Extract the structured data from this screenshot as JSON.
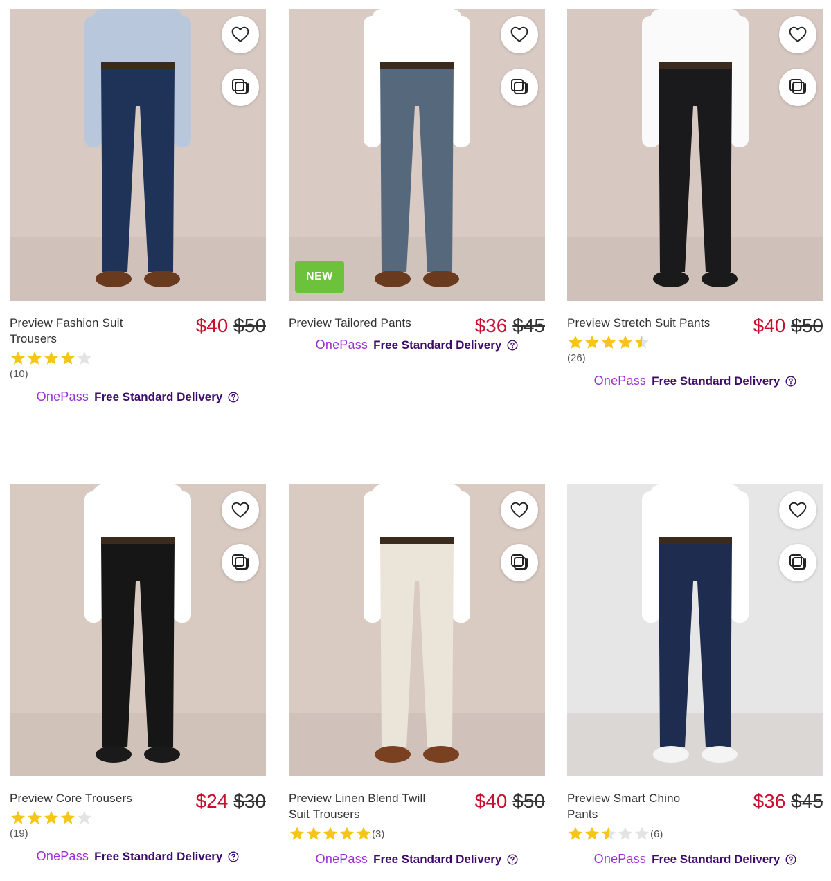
{
  "delivery": {
    "brand": "OnePass",
    "text": "Free Standard Delivery"
  },
  "colors": {
    "sale_price": "#c8102e",
    "onepass": "#9b2fd4",
    "delivery_text": "#3d0a6e",
    "new_badge": "#6cc23a",
    "star": "#f5c518"
  },
  "icons": [
    "heart-icon",
    "compare-icon",
    "star-icon",
    "help-circle-icon"
  ],
  "products": [
    {
      "name": "Preview Fashion Suit Trousers",
      "price": "$40",
      "was_price": "$50",
      "rating": 4,
      "reviews": "(10)",
      "badge": "",
      "pants_color": "#1f3358",
      "shirt_color": "#b9c7dc",
      "shoes_color": "#6a3a1e",
      "bg_color": "#d8cac3"
    },
    {
      "name": "Preview Tailored Pants",
      "price": "$36",
      "was_price": "$45",
      "rating": null,
      "reviews": "",
      "badge": "NEW",
      "pants_color": "#56697c",
      "shirt_color": "#ffffff",
      "shoes_color": "#6a3a1e",
      "bg_color": "#d9cbc4"
    },
    {
      "name": "Preview Stretch Suit Pants",
      "price": "$40",
      "was_price": "$50",
      "rating": 4.5,
      "reviews": "(26)",
      "badge": "",
      "pants_color": "#1a1a1c",
      "shirt_color": "#fafafa",
      "shoes_color": "#1a1a1a",
      "bg_color": "#d7c9c2"
    },
    {
      "name": "Preview Core Trousers",
      "price": "$24",
      "was_price": "$30",
      "rating": 4,
      "reviews": "(19)",
      "badge": "",
      "pants_color": "#161616",
      "shirt_color": "#ffffff",
      "shoes_color": "#1a1a1a",
      "bg_color": "#d8c9c1"
    },
    {
      "name": "Preview Linen Blend Twill Suit Trousers",
      "price": "$40",
      "was_price": "$50",
      "rating": 5,
      "reviews": "(3)",
      "badge": "",
      "pants_color": "#ebe4d8",
      "shirt_color": "#ffffff",
      "shoes_color": "#7a4022",
      "bg_color": "#d9cac2"
    },
    {
      "name": "Preview Smart Chino Pants",
      "price": "$36",
      "was_price": "$45",
      "rating": 2.5,
      "reviews": "(6)",
      "badge": "",
      "pants_color": "#1e2d4f",
      "shirt_color": "#ffffff",
      "shoes_color": "#f4f4f4",
      "bg_color": "#e6e6e6"
    }
  ]
}
